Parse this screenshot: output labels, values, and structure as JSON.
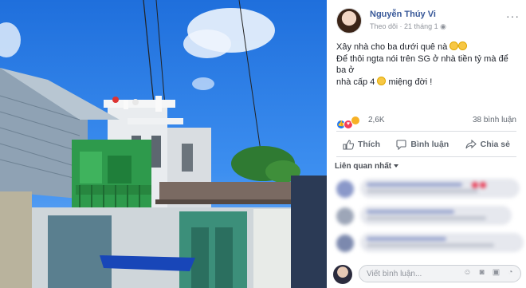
{
  "post": {
    "author": "Nguyễn Thúy Vi",
    "follow_label": "Theo dõi",
    "date": "21 tháng 1",
    "more_label": "···",
    "text_line1": "Xây nhà cho ba dưới quê nà",
    "text_line2": "Để thôi ngta nói trên SG ở nhà tiền tỷ mà để ba ở",
    "text_line3": "nhà cấp 4",
    "text_line3_end": "miệng đời !"
  },
  "stats": {
    "reactions_count": "2,6K",
    "comments_count": "38 bình luận"
  },
  "actions": {
    "like": "Thích",
    "comment": "Bình luận",
    "share": "Chia sẻ"
  },
  "comments": {
    "sort_label": "Liên quan nhất"
  },
  "comment_box": {
    "placeholder": "Viết bình luận..."
  },
  "colors": {
    "link_blue": "#385898",
    "sky": "#2f7de3",
    "house_green": "#2e9a4c"
  }
}
